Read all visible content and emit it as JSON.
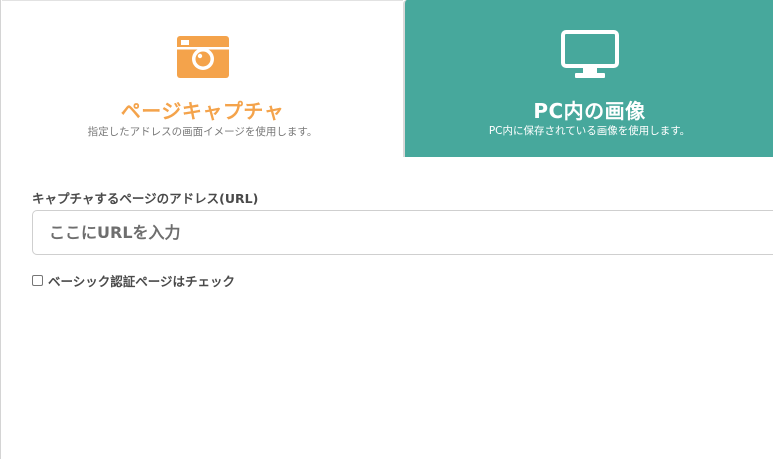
{
  "tabs": {
    "capture": {
      "title": "ページキャプチャ",
      "description": "指定したアドレスの画面イメージを使用します。",
      "icon": "camera-icon",
      "accent_color": "#f4a34b",
      "active": true
    },
    "pc_image": {
      "title": "PC内の画像",
      "description": "PC内に保存されている画像を使用します。",
      "icon": "monitor-icon",
      "background_color": "#47a89c",
      "active": false
    }
  },
  "form": {
    "url_label": "キャプチャするページのアドレス(URL)",
    "url_placeholder": "ここにURLを入力",
    "url_value": "",
    "basic_auth_label": "ベーシック認証ページはチェック",
    "basic_auth_checked": false
  }
}
